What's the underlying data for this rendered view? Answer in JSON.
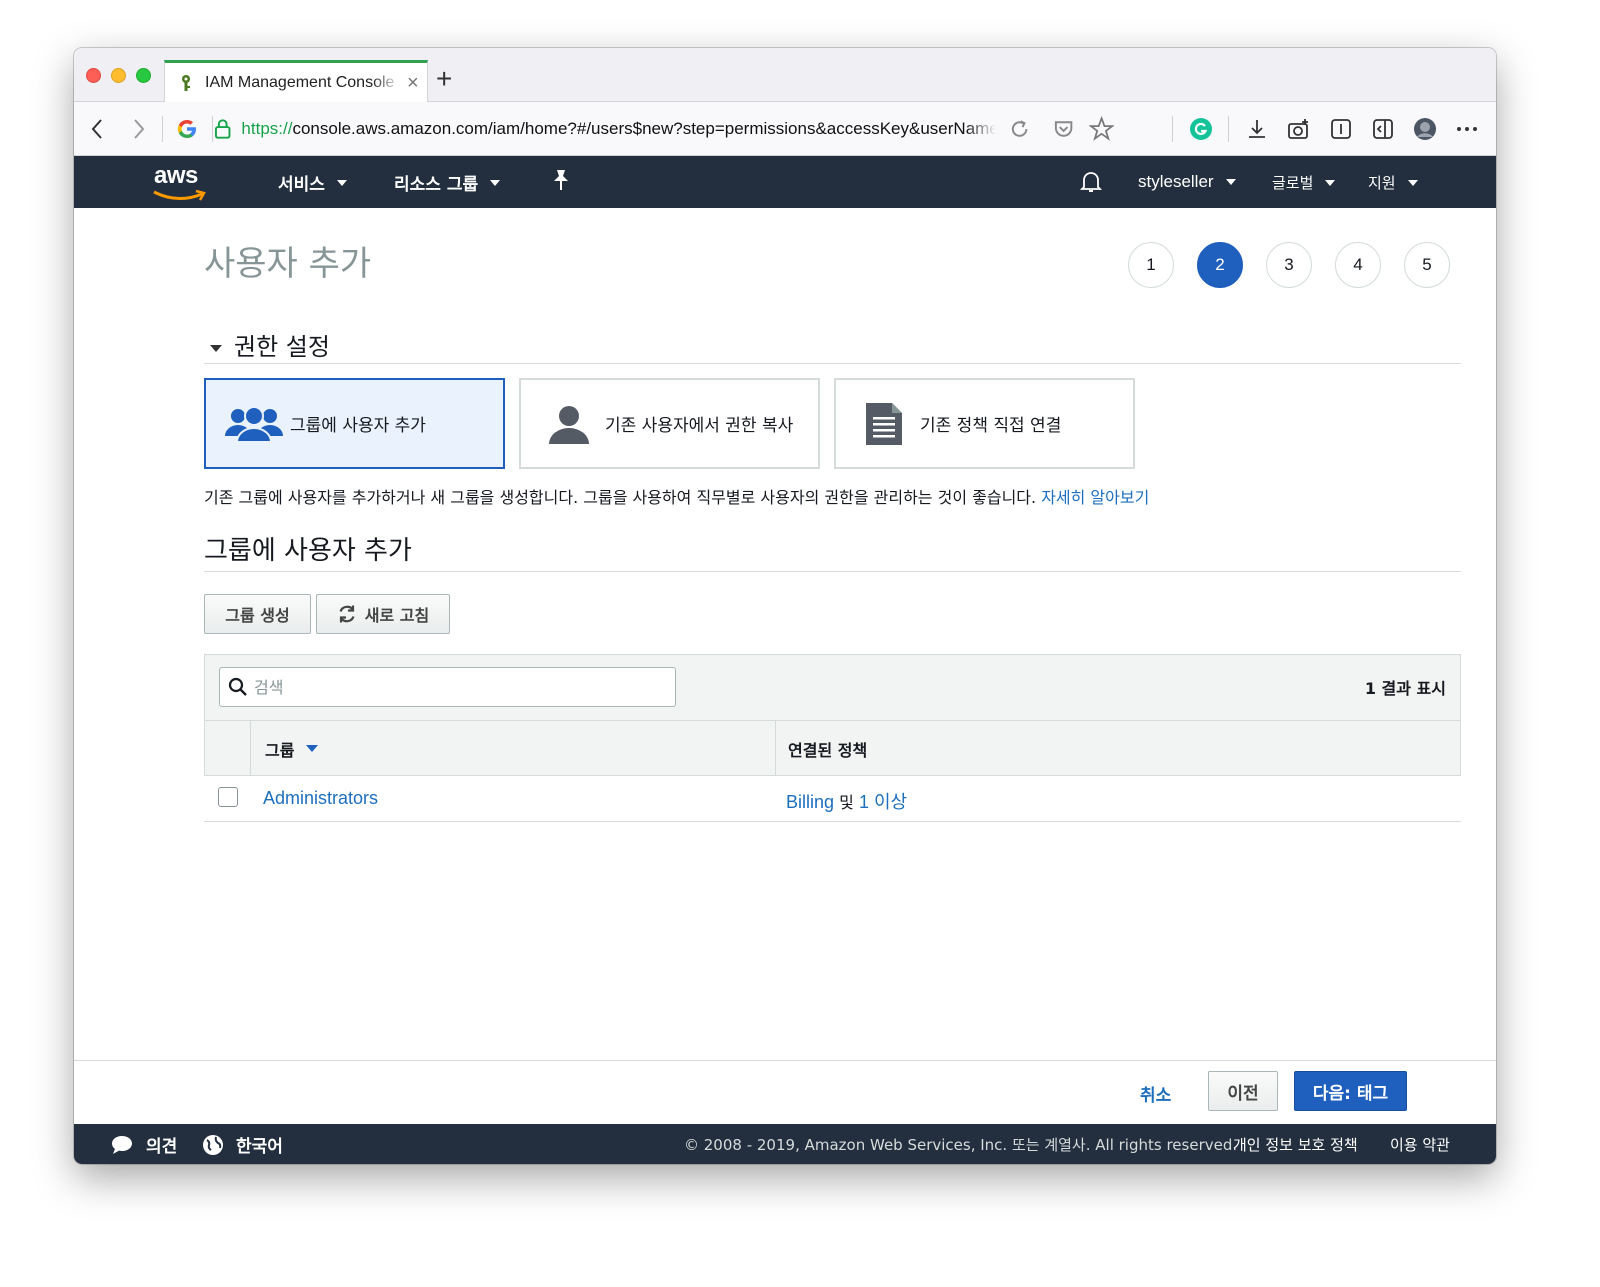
{
  "browser": {
    "tab_title": "IAM Management Console",
    "new_tab": "+",
    "tab_close": "×",
    "url_scheme": "https://",
    "url_rest": "console.aws.amazon.com/iam/home?#/users$new?step=permissions&accessKey&userName"
  },
  "awsnav": {
    "logo": "aws",
    "services": "서비스",
    "resource_groups": "리소스 그룹",
    "account": "styleseller",
    "region": "글로벌",
    "support": "지원"
  },
  "page": {
    "title": "사용자 추가",
    "steps": [
      "1",
      "2",
      "3",
      "4",
      "5"
    ],
    "active_step": "2"
  },
  "permissions": {
    "section_title": "권한 설정",
    "options": [
      {
        "label": "그룹에 사용자 추가",
        "icon": "group-icon",
        "selected": true
      },
      {
        "label": "기존 사용자에서 권한 복사",
        "icon": "user-icon",
        "selected": false
      },
      {
        "label": "기존 정책 직접 연결",
        "icon": "document-icon",
        "selected": false
      }
    ],
    "description": "기존 그룹에 사용자를 추가하거나 새 그룹을 생성합니다. 그룹을 사용하여 직무별로 사용자의 권한을 관리하는 것이 좋습니다. ",
    "learn_more": "자세히 알아보기"
  },
  "groups": {
    "section_title": "그룹에 사용자 추가",
    "create_button": "그룹 생성",
    "refresh_button": "새로 고침",
    "search_placeholder": "검색",
    "result_count": "1 결과 표시",
    "columns": [
      "그룹",
      "연결된 정책"
    ],
    "rows": [
      {
        "group": "Administrators",
        "policy_link": "Billing",
        "policy_and": " 및 ",
        "policy_more": "1 이상",
        "checked": false
      }
    ]
  },
  "footer": {
    "cancel": "취소",
    "previous": "이전",
    "next": "다음: 태그"
  },
  "bottom_bar": {
    "feedback": "의견",
    "language": "한국어",
    "copyright": "© 2008 - 2019, Amazon Web Services, Inc. 또는 계열사. All rights reserved.",
    "privacy": "개인 정보 보호 정책",
    "terms": "이용 약관"
  },
  "colors": {
    "aws_nav": "#232f3e",
    "accent_blue": "#1f5fbd",
    "link_blue": "#1d6fbd",
    "aws_orange": "#ff9900"
  }
}
